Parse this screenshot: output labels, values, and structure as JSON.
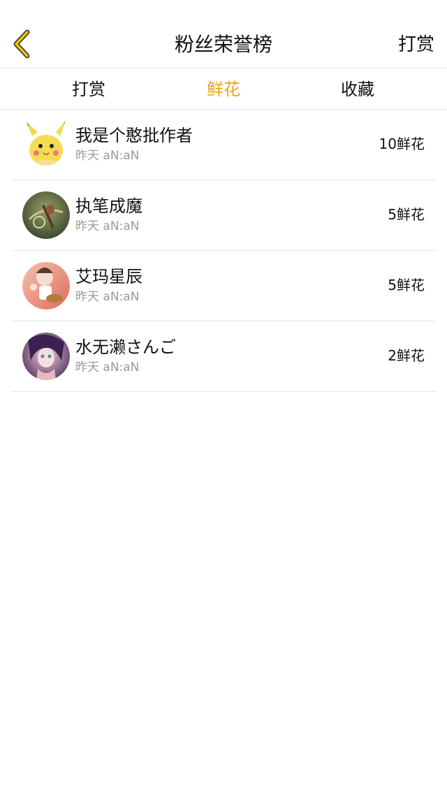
{
  "header": {
    "title": "粉丝荣誉榜",
    "action_label": "打赏",
    "back_icon": "chevron-left-icon",
    "accent_color": "#f0c200"
  },
  "tabs": [
    {
      "label": "打赏",
      "active": false
    },
    {
      "label": "鲜花",
      "active": true
    },
    {
      "label": "收藏",
      "active": false
    }
  ],
  "active_color": "#f0a21e",
  "fans": [
    {
      "name": "我是个憨批作者",
      "time": "昨天 aN:aN",
      "count": "10鲜花",
      "avatar": "pikachu-avatar"
    },
    {
      "name": "执笔成魔",
      "time": "昨天 aN:aN",
      "count": "5鲜花",
      "avatar": "warrior-avatar"
    },
    {
      "name": "艾玛星辰",
      "time": "昨天 aN:aN",
      "count": "5鲜花",
      "avatar": "anime-girl-hat-avatar"
    },
    {
      "name": "水无濑さんご",
      "time": "昨天 aN:aN",
      "count": "2鲜花",
      "avatar": "anime-girl-purple-avatar"
    }
  ]
}
